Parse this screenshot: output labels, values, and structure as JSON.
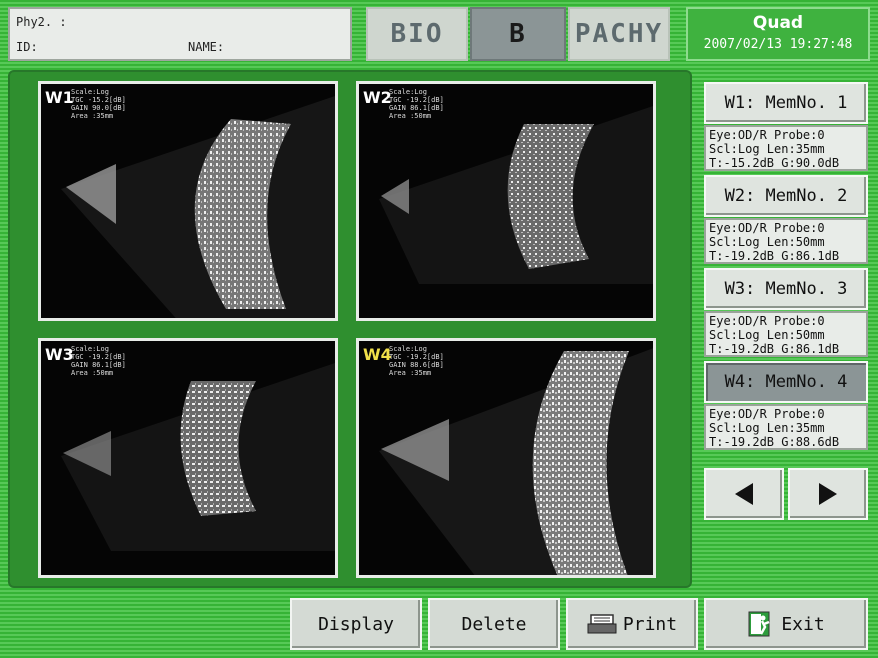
{
  "header": {
    "phy_label": "Phy2. :",
    "id_label": "ID:",
    "name_label": "NAME:",
    "tabs": [
      {
        "label": "BIO",
        "selected": false
      },
      {
        "label": "B",
        "selected": true
      },
      {
        "label": "PACHY",
        "selected": false
      }
    ],
    "layout_mode": "Quad",
    "datetime": "2007/02/13 19:27:48"
  },
  "windows": [
    {
      "label": "W1",
      "info": "Scale:Log\nTGC -15.2[dB]\nGAIN 90.0[dB]\nArea :35mm",
      "highlighted": false
    },
    {
      "label": "W2",
      "info": "Scale:Log\nTGC -19.2[dB]\nGAIN 86.1[dB]\nArea :50mm",
      "highlighted": false
    },
    {
      "label": "W3",
      "info": "Scale:Log\nTGC -19.2[dB]\nGAIN 86.1[dB]\nArea :50mm",
      "highlighted": false
    },
    {
      "label": "W4",
      "info": "Scale:Log\nTGC -19.2[dB]\nGAIN 88.6[dB]\nArea :35mm",
      "highlighted": true
    }
  ],
  "memories": [
    {
      "title": "W1: MemNo.  1",
      "line1": "Eye:OD/R Probe:0",
      "line2": "Scl:Log Len:35mm",
      "line3": "T:-15.2dB G:90.0dB",
      "selected": false
    },
    {
      "title": "W2: MemNo.  2",
      "line1": "Eye:OD/R Probe:0",
      "line2": "Scl:Log Len:50mm",
      "line3": "T:-19.2dB G:86.1dB",
      "selected": false
    },
    {
      "title": "W3: MemNo.  3",
      "line1": "Eye:OD/R Probe:0",
      "line2": "Scl:Log Len:50mm",
      "line3": "T:-19.2dB G:86.1dB",
      "selected": false
    },
    {
      "title": "W4: MemNo.  4",
      "line1": "Eye:OD/R Probe:0",
      "line2": "Scl:Log Len:35mm",
      "line3": "T:-19.2dB G:88.6dB",
      "selected": true
    }
  ],
  "nav": {
    "prev_icon": "left-arrow-icon",
    "next_icon": "right-arrow-icon"
  },
  "buttons": {
    "display": "Display",
    "delete": "Delete",
    "print": "Print",
    "exit": "Exit"
  },
  "colors": {
    "background_green": "#36b336",
    "panel_green": "#2f8f2f",
    "selected_gray": "#8b9596",
    "label_highlight": "#f0e04a"
  }
}
